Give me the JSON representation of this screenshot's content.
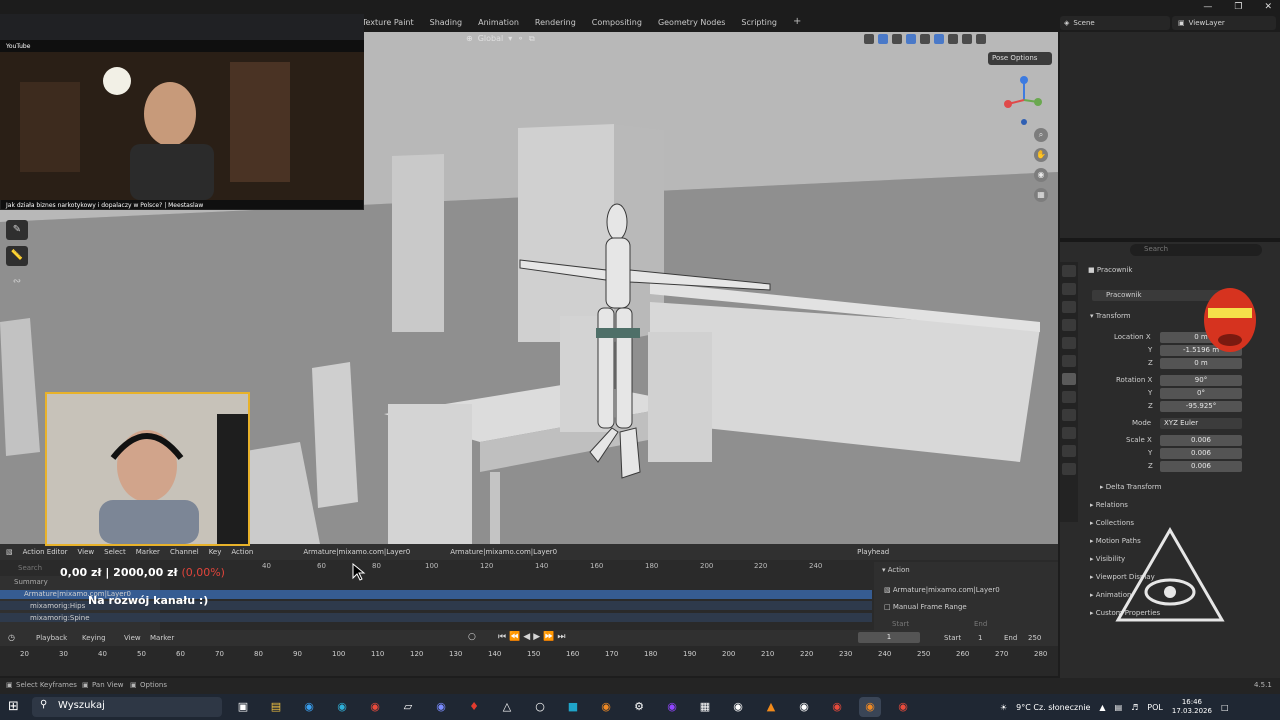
{
  "top": {
    "workspace_tabs": [
      "Texture Paint",
      "Shading",
      "Animation",
      "Rendering",
      "Compositing",
      "Geometry Nodes",
      "Scripting"
    ],
    "add_tab": "+",
    "scene": "Scene",
    "view_layer": "ViewLayer"
  },
  "viewport": {
    "orientation": "Global",
    "pose_options": "Pose Options"
  },
  "youtube": {
    "logo": "YouTube",
    "video_title": "Jak działa biznes narkotykowy i dopalaczy w Polsce? | Meestaslaw"
  },
  "properties": {
    "search_placeholder": "Search",
    "object_name": "Pracownik",
    "data_name": "Pracownik",
    "transform": "Transform",
    "location_x": "Location X",
    "loc_y_label": "Y",
    "loc_z_label": "Z",
    "loc_x_val": "0 m",
    "loc_y_val": "-1.5196 m",
    "loc_z_val": "0 m",
    "rotation_x": "Rotation X",
    "rot_y_label": "Y",
    "rot_z_label": "Z",
    "rot_x_val": "90°",
    "rot_y_val": "0°",
    "rot_z_val": "-95.925°",
    "mode_label": "Mode",
    "mode_val": "XYZ Euler",
    "scale_x": "Scale X",
    "scale_y_label": "Y",
    "scale_z_label": "Z",
    "scale_x_val": "0.006",
    "scale_y_val": "0.006",
    "scale_z_val": "0.006",
    "delta_transform": "Delta Transform",
    "relations": "Relations",
    "collections": "Collections",
    "motion_paths": "Motion Paths",
    "visibility": "Visibility",
    "viewport_display": "Viewport Display",
    "animation": "Animation",
    "custom_properties": "Custom Properties"
  },
  "action_editor": {
    "editor_type": "Action Editor",
    "menus": [
      "View",
      "Select",
      "Marker",
      "Channel",
      "Key",
      "Action"
    ],
    "action_name_1": "Armature|mixamo.com|Layer0",
    "action_name_2": "Armature|mixamo.com|Layer0",
    "playback": "Playhead",
    "search": "Search",
    "summary": "Summary",
    "channels": [
      "Armature|mixamo.com|Layer0",
      "mixamorig:Hips",
      "mixamorig:Spine"
    ],
    "ruler": [
      "40",
      "60",
      "80",
      "100",
      "120",
      "140",
      "160",
      "180",
      "200",
      "220",
      "240"
    ],
    "side_action": "Action",
    "side_action_name": "Armature|mixamo.com|Layer0",
    "manual_frame_range": "Manual Frame Range",
    "start": "Start",
    "end": "End"
  },
  "timeline": {
    "menus": [
      "Playback",
      "Keying",
      "View",
      "Marker"
    ],
    "current_frame": "1",
    "start_label": "Start",
    "start_val": "1",
    "end_label": "End",
    "end_val": "250",
    "ruler": [
      "20",
      "30",
      "40",
      "50",
      "60",
      "70",
      "80",
      "90",
      "100",
      "110",
      "120",
      "130",
      "140",
      "150",
      "160",
      "170",
      "180",
      "190",
      "200",
      "210",
      "220",
      "230",
      "240",
      "250",
      "260",
      "270",
      "280"
    ]
  },
  "status": {
    "left": "Select Keyframes",
    "middle": "Pan View",
    "right": "Options",
    "version": "4.5.1"
  },
  "overlay": {
    "donation": "0,00 zł",
    "goal": "2000,00 zł",
    "percent": "(0,00%)",
    "caption": "Na rozwój kanału :)"
  },
  "taskbar": {
    "search": "Wyszukaj",
    "weather": "9°C Cz. słonecznie",
    "lang": "POL",
    "time": "16:46",
    "date": "17.03.2026"
  }
}
